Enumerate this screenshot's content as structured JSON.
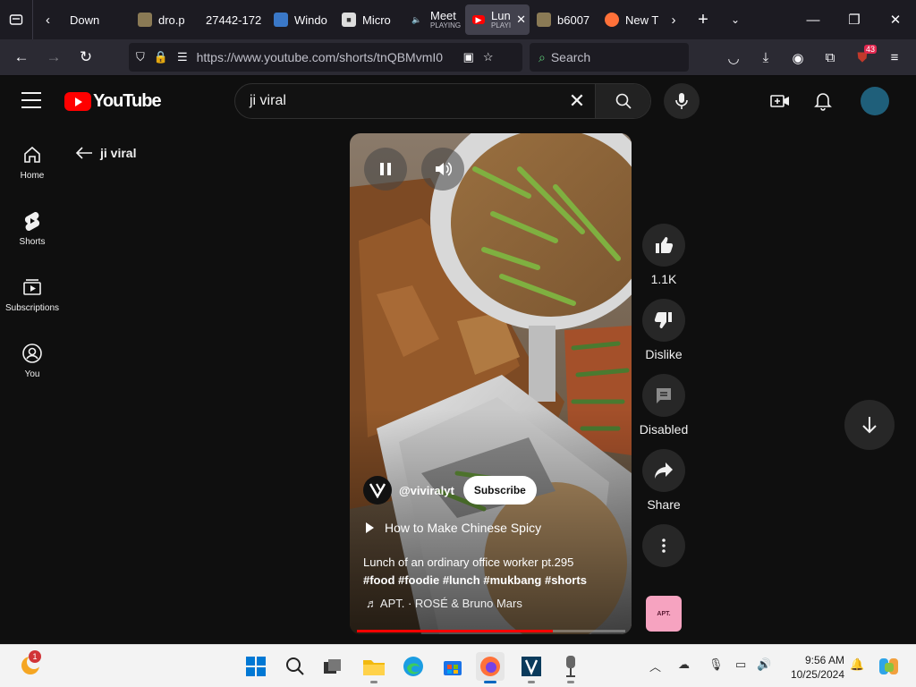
{
  "browser": {
    "tabs": [
      {
        "label": "Down",
        "favicon": "download-icon"
      },
      {
        "label": "dro.p",
        "favicon": "folder-icon"
      },
      {
        "label": "27442-172",
        "favicon": "none"
      },
      {
        "label": "Windo",
        "favicon": "windows-icon"
      },
      {
        "label": "Micro",
        "favicon": "store-icon"
      },
      {
        "label": "Meet",
        "sublabel": "PLAYING",
        "favicon": "speaker-icon"
      },
      {
        "label": "Lun",
        "sublabel": "PLAYI",
        "favicon": "youtube-icon",
        "active": true
      },
      {
        "label": "b6007",
        "favicon": "folder-icon"
      },
      {
        "label": "New T",
        "favicon": "firefox-icon"
      }
    ],
    "url": "https://www.youtube.com/shorts/tnQBMvmI0",
    "search_placeholder": "Search",
    "extension_badge": "43"
  },
  "youtube": {
    "logo_text": "YouTube",
    "search_query": "ji viral",
    "guide": [
      {
        "label": "Home",
        "icon": "home-icon"
      },
      {
        "label": "Shorts",
        "icon": "shorts-icon"
      },
      {
        "label": "Subscriptions",
        "icon": "subscriptions-icon"
      },
      {
        "label": "You",
        "icon": "you-icon"
      }
    ],
    "back_label": "ji viral",
    "short": {
      "channel": "@viviralyt",
      "subscribe_label": "Subscribe",
      "related_title": "How to Make Chinese Spicy",
      "caption": "Lunch of an ordinary office worker pt.295",
      "hashtags": "#food #foodie #lunch #mukbang #shorts",
      "music": "♬ APT. · ROSÉ & Bruno Mars",
      "progress_percent": 73
    },
    "actions": [
      {
        "label": "1.1K",
        "icon": "like-icon"
      },
      {
        "label": "Dislike",
        "icon": "dislike-icon"
      },
      {
        "label": "Disabled",
        "icon": "comments-icon"
      },
      {
        "label": "Share",
        "icon": "share-icon"
      }
    ],
    "music_thumb_text": "APT."
  },
  "taskbar": {
    "notification_count": "1",
    "time": "9:56 AM",
    "date": "10/25/2024"
  },
  "colors": {
    "youtube_red": "#ff0000",
    "background": "#0f0f0f"
  }
}
